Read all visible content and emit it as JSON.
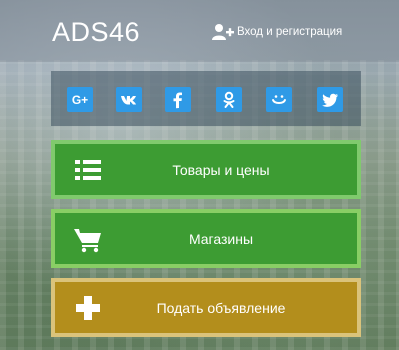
{
  "header": {
    "logo": "ADS46",
    "login_label": "Вход и регистрация"
  },
  "social": {
    "items": [
      {
        "name": "google-plus",
        "label": "G+",
        "color": "#2f9ae6"
      },
      {
        "name": "vk",
        "color": "#2f9ae6"
      },
      {
        "name": "facebook",
        "color": "#2f9ae6"
      },
      {
        "name": "odnoklassniki",
        "color": "#2f9ae6"
      },
      {
        "name": "moi-mir",
        "color": "#2f9ae6"
      },
      {
        "name": "twitter",
        "color": "#2f9ae6"
      }
    ]
  },
  "actions": {
    "goods_label": "Товары и цены",
    "shops_label": "Магазины",
    "post_label": "Подать объявление",
    "goods_color": "#3d9c33",
    "shops_color": "#3d9c33",
    "post_color": "#b38e1c"
  }
}
